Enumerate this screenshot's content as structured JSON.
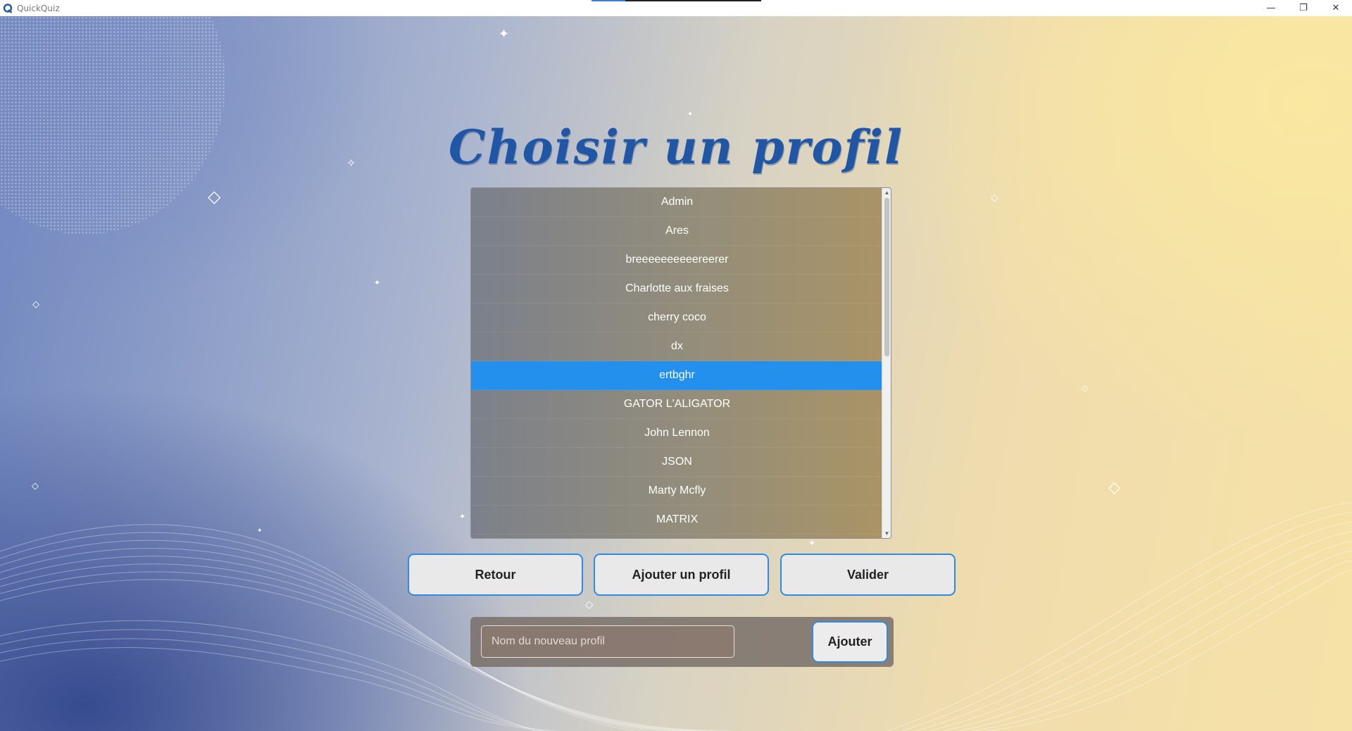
{
  "window": {
    "title": "QuickQuiz",
    "minimize_glyph": "—",
    "restore_glyph": "❐",
    "close_glyph": "✕",
    "loading_progress": 0.2
  },
  "page": {
    "title": "Choisir un profil"
  },
  "profiles": {
    "items": [
      "Admin",
      "Ares",
      "breeeeeeeeeereerer",
      "Charlotte aux fraises",
      "cherry coco",
      "dx",
      "ertbghr",
      "GATOR L'ALIGATOR",
      "John Lennon",
      "JSON",
      "Marty Mcfly",
      "MATRIX"
    ],
    "selected": "ertbghr"
  },
  "buttons": {
    "back": "Retour",
    "add_profile": "Ajouter un profil",
    "validate": "Valider"
  },
  "new_profile": {
    "placeholder": "Nom du nouveau profil",
    "add_label": "Ajouter"
  },
  "colors": {
    "title": "#1f56a6",
    "selection": "#2490ee",
    "button_border": "#2e8ae6"
  }
}
